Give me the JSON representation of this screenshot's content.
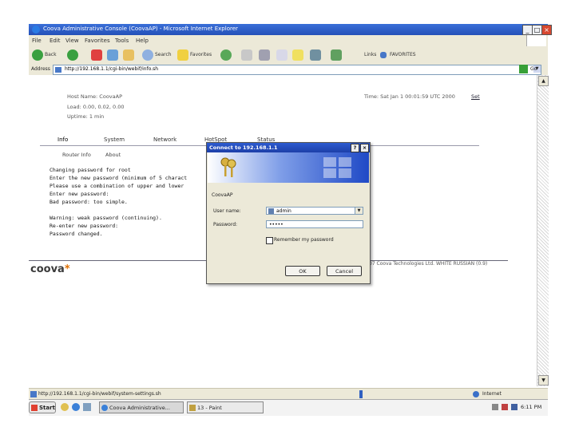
{
  "window": {
    "title": "Coova Administrative Console (CoovaAP) - Microsoft Internet Explorer",
    "min": "_",
    "max": "□",
    "close": "×"
  },
  "menu": [
    "File",
    "Edit",
    "View",
    "Favorites",
    "Tools",
    "Help"
  ],
  "toolbar": {
    "back": "Back",
    "search": "Search",
    "favorites": "Favorites",
    "links": "Links",
    "link1": "FAVORITES"
  },
  "address": {
    "label": "Address",
    "url": "http://192.168.1.1/cgi-bin/webif/info.sh",
    "go": "Go"
  },
  "page": {
    "host_name": "Host Name: CoovaAP",
    "load": "Load: 0.00, 0.02, 0.00",
    "uptime": "Uptime: 1 min",
    "time": "Time: Sat Jan 1 00:01:59 UTC 2000",
    "time_link": "Set",
    "tabs": [
      "Info",
      "System",
      "Network",
      "HotSpot",
      "Status"
    ],
    "subtabs": [
      "Router Info",
      "About"
    ],
    "console_lines": [
      "Changing password for root",
      "Enter the new password (minimum of 5 charact",
      "Please use a combination of upper and lower",
      "Enter new password:",
      "Bad password: too simple.",
      "",
      "Warning: weak password (continuing).",
      "Re-enter new password:",
      "Password changed."
    ],
    "logo": "coova",
    "logo_star": "*",
    "copyright": "07 Coova Technologies Ltd. WHITE RUSSIAN (0.9)"
  },
  "dialog": {
    "title": "Connect to 192.168.1.1",
    "help": "?",
    "close": "×",
    "realm": "CoovaAP",
    "username_label": "User name:",
    "username_value": "admin",
    "password_label": "Password:",
    "password_value": "•••••",
    "remember": "Remember my password",
    "ok": "OK",
    "cancel": "Cancel"
  },
  "status": {
    "text": "http://192.168.1.1/cgi-bin/webif/system-settings.sh",
    "zone": "Internet"
  },
  "taskbar": {
    "start": "Start",
    "task1": "Coova Administrative...",
    "task2": "13 - Paint",
    "clock": "6:11 PM"
  }
}
